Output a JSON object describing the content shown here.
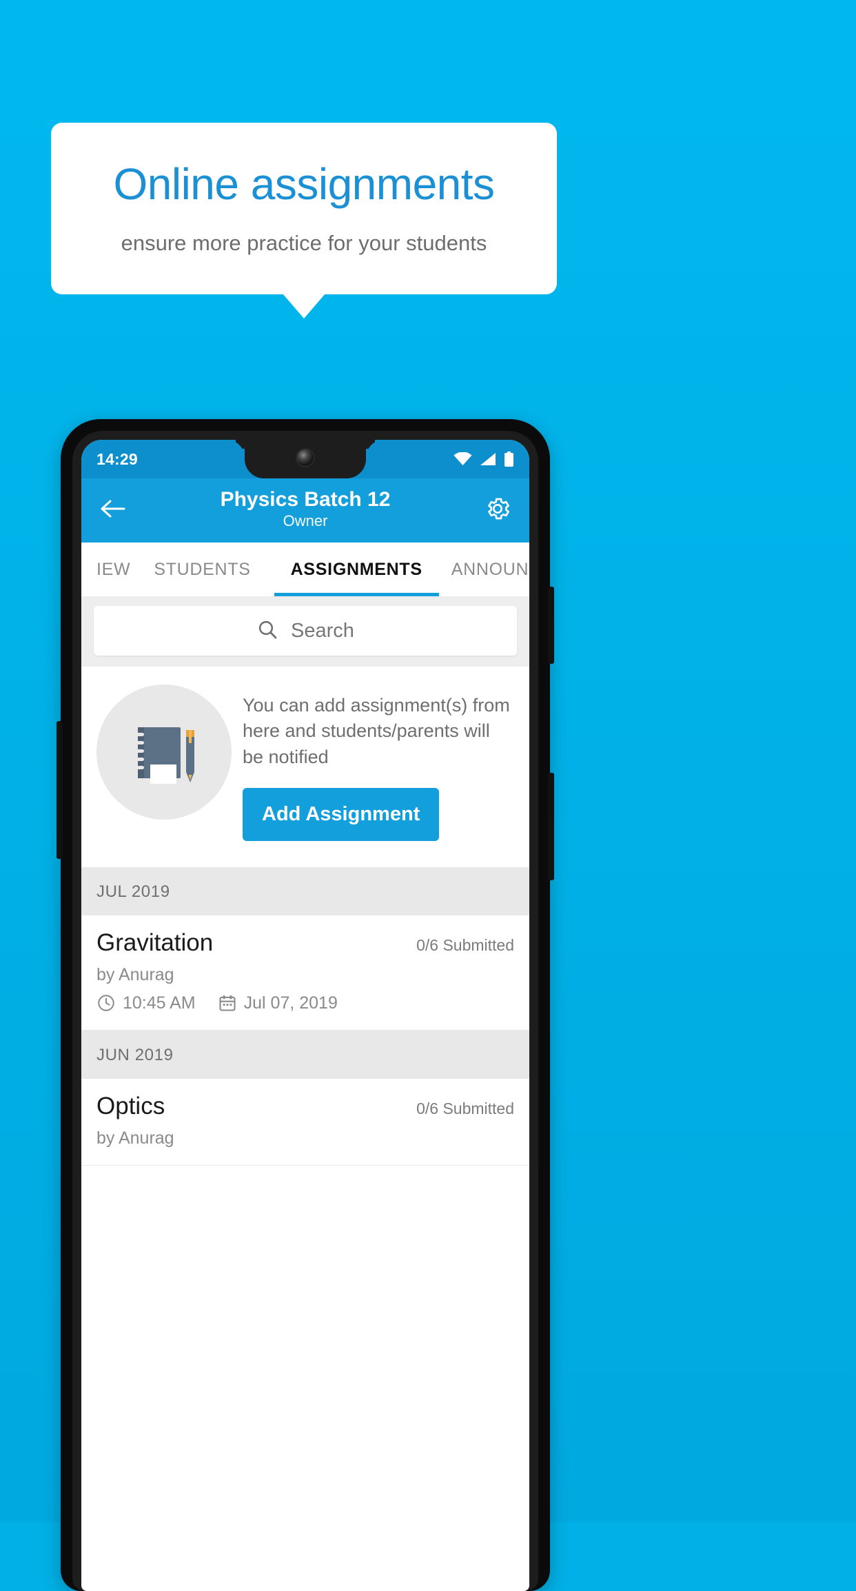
{
  "promo": {
    "title": "Online assignments",
    "subtitle": "ensure more practice for your students",
    "title_color": "#1b90d4",
    "background_color": "#00b0e6"
  },
  "phone": {
    "status_bar": {
      "time": "14:29",
      "icons": [
        "wifi-icon",
        "signal-icon",
        "battery-icon"
      ],
      "background_color": "#0d8fce"
    },
    "app_bar": {
      "back_icon": "back-arrow-icon",
      "title": "Physics Batch 12",
      "subtitle": "Owner",
      "settings_icon": "gear-icon",
      "background_color": "#139fdc"
    },
    "tabs": [
      {
        "label": "IEW",
        "active": false
      },
      {
        "label": "STUDENTS",
        "active": false
      },
      {
        "label": "ASSIGNMENTS",
        "active": true
      },
      {
        "label": "ANNOUNCEM",
        "active": false
      }
    ],
    "search": {
      "icon": "search-icon",
      "placeholder": "Search",
      "value": ""
    },
    "empty_state": {
      "illustration": "notebook-and-pen-icon",
      "message": "You can add assignment(s) from here and students/parents will be notified",
      "button_label": "Add Assignment"
    },
    "groups": [
      {
        "month": "JUL 2019",
        "items": [
          {
            "title": "Gravitation",
            "submitted": "0/6 Submitted",
            "author": "by Anurag",
            "time": "10:45 AM",
            "date": "Jul 07, 2019",
            "clock_icon": "clock-icon",
            "calendar_icon": "calendar-icon"
          }
        ]
      },
      {
        "month": "JUN 2019",
        "items": [
          {
            "title": "Optics",
            "submitted": "0/6 Submitted",
            "author": "by Anurag",
            "time": "",
            "date": "",
            "clock_icon": "clock-icon",
            "calendar_icon": "calendar-icon"
          }
        ]
      }
    ]
  }
}
